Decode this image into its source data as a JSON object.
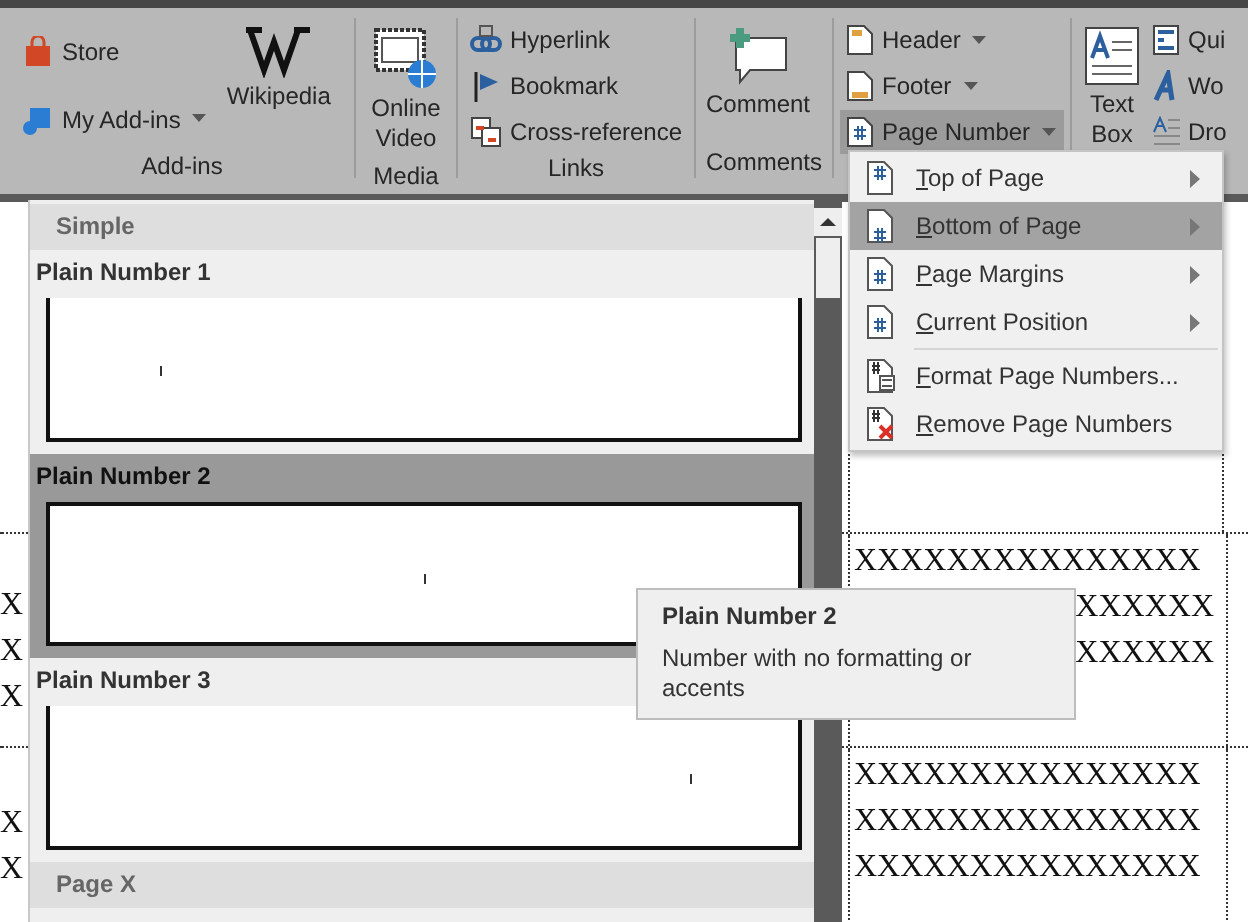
{
  "ribbon": {
    "add_ins": {
      "label": "Add-ins",
      "store": "Store",
      "my_add_ins": "My Add-ins",
      "wikipedia": "Wikipedia"
    },
    "media": {
      "label": "Media",
      "online_video": "Online Video"
    },
    "links": {
      "label": "Links",
      "items": [
        "Hyperlink",
        "Bookmark",
        "Cross-reference"
      ]
    },
    "comments": {
      "label": "Comments",
      "comment": "Comment"
    },
    "header_footer": {
      "items": [
        {
          "label": "Header",
          "selected": false
        },
        {
          "label": "Footer",
          "selected": false
        },
        {
          "label": "Page Number",
          "selected": true
        }
      ]
    },
    "text": {
      "text_box": "Text Box",
      "items": [
        "Qui",
        "Wo",
        "Dro"
      ]
    }
  },
  "menu": {
    "items": [
      {
        "label": "Top of Page",
        "kind": "submenu",
        "selected": false
      },
      {
        "label": "Bottom of Page",
        "kind": "submenu",
        "selected": true
      },
      {
        "label": "Page Margins",
        "kind": "submenu",
        "selected": false
      },
      {
        "label": "Current Position",
        "kind": "submenu",
        "selected": false
      },
      {
        "label": "Format Page Numbers...",
        "kind": "command",
        "selected": false
      },
      {
        "label": "Remove Page Numbers",
        "kind": "command",
        "selected": false
      }
    ]
  },
  "gallery": {
    "entries": [
      {
        "kind": "heading",
        "label": "Simple"
      },
      {
        "kind": "item",
        "label": "Plain Number 1",
        "selected": false
      },
      {
        "kind": "item",
        "label": "Plain Number 2",
        "selected": true
      },
      {
        "kind": "item",
        "label": "Plain Number 3",
        "selected": false
      },
      {
        "kind": "heading",
        "label": "Page X"
      }
    ]
  },
  "tooltip": {
    "title": "Plain Number 2",
    "body": "Number with no formatting or accents"
  },
  "document": {
    "rows": [
      {
        "left": [],
        "right": []
      },
      {
        "left": [
          "X",
          "X",
          "X"
        ],
        "right": [
          "XXXXXXXXXXXXXXX",
          "XXXXXX",
          "XXXXXX"
        ]
      },
      {
        "left": [
          "X",
          "X"
        ],
        "right": [
          "XXXXXXXXXXXXXXX",
          "XXXXXXXXXXXXXXX",
          "XXXXXXXXXXXXXXX"
        ]
      }
    ]
  }
}
